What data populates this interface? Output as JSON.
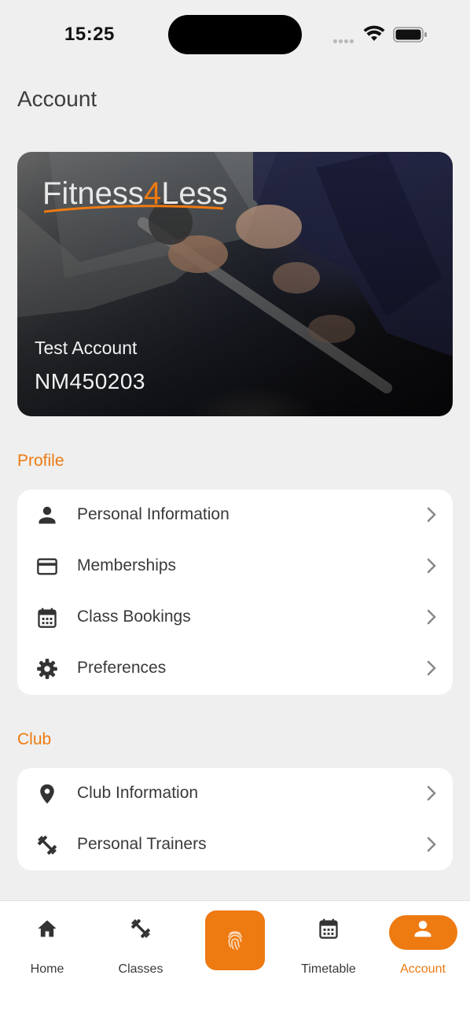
{
  "status_bar": {
    "time": "15:25"
  },
  "page": {
    "title": "Account"
  },
  "card": {
    "brand_part1": "Fitness",
    "brand_part2": "4",
    "brand_part3": "Less",
    "name": "Test Account",
    "number": "NM450203"
  },
  "profile": {
    "section_title": "Profile",
    "items": [
      {
        "label": "Personal Information",
        "icon": "person-icon"
      },
      {
        "label": "Memberships",
        "icon": "credit-card-icon"
      },
      {
        "label": "Class Bookings",
        "icon": "calendar-icon"
      },
      {
        "label": "Preferences",
        "icon": "gear-icon"
      }
    ]
  },
  "club": {
    "section_title": "Club",
    "items": [
      {
        "label": "Club Information",
        "icon": "location-pin-icon"
      },
      {
        "label": "Personal Trainers",
        "icon": "dumbbell-icon"
      }
    ]
  },
  "bottom_nav": {
    "items": [
      {
        "label": "Home",
        "icon": "home-icon"
      },
      {
        "label": "Classes",
        "icon": "dumbbell-icon"
      },
      {
        "label": "",
        "icon": "fingerprint-icon"
      },
      {
        "label": "Timetable",
        "icon": "calendar-icon"
      },
      {
        "label": "Account",
        "icon": "person-icon",
        "active": true
      }
    ]
  },
  "colors": {
    "accent": "#ee7a12",
    "background": "#efefef",
    "text": "#3a3a3a"
  }
}
